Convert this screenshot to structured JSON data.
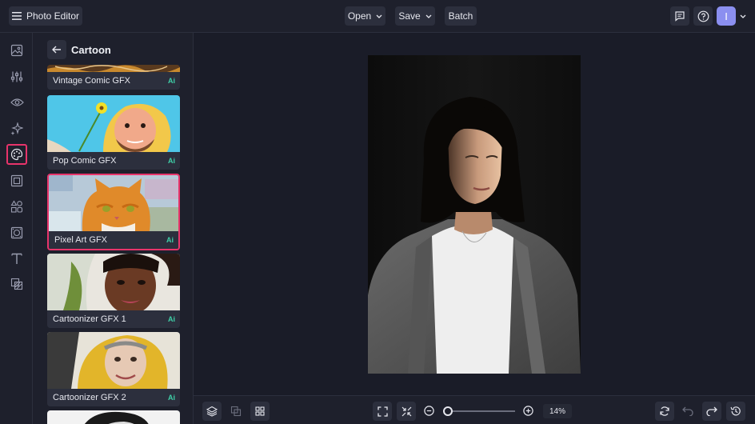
{
  "app": {
    "title": "Photo Editor",
    "avatar_initial": "I"
  },
  "topbar": {
    "open_label": "Open",
    "save_label": "Save",
    "batch_label": "Batch"
  },
  "panel": {
    "title": "Cartoon",
    "items": [
      {
        "label": "Vintage Comic GFX",
        "badge": "Ai"
      },
      {
        "label": "Pop Comic GFX",
        "badge": "Ai"
      },
      {
        "label": "Pixel Art GFX",
        "badge": "Ai"
      },
      {
        "label": "Cartoonizer GFX 1",
        "badge": "Ai"
      },
      {
        "label": "Cartoonizer GFX 2",
        "badge": "Ai"
      }
    ]
  },
  "zoom": {
    "value": "14%"
  },
  "colors": {
    "accent": "#e8346b",
    "ai_badge": "#3fd0a8",
    "avatar": "#8b8ff0",
    "background": "#1a1c28",
    "panel": "#1e202c"
  },
  "icons": {
    "rail": [
      "image-icon",
      "adjust-sliders-icon",
      "eye-icon",
      "sparkle-effects-icon",
      "palette-artsy-icon",
      "frame-icon",
      "shapes-icon",
      "overlay-icon",
      "text-icon",
      "texture-icon"
    ]
  }
}
